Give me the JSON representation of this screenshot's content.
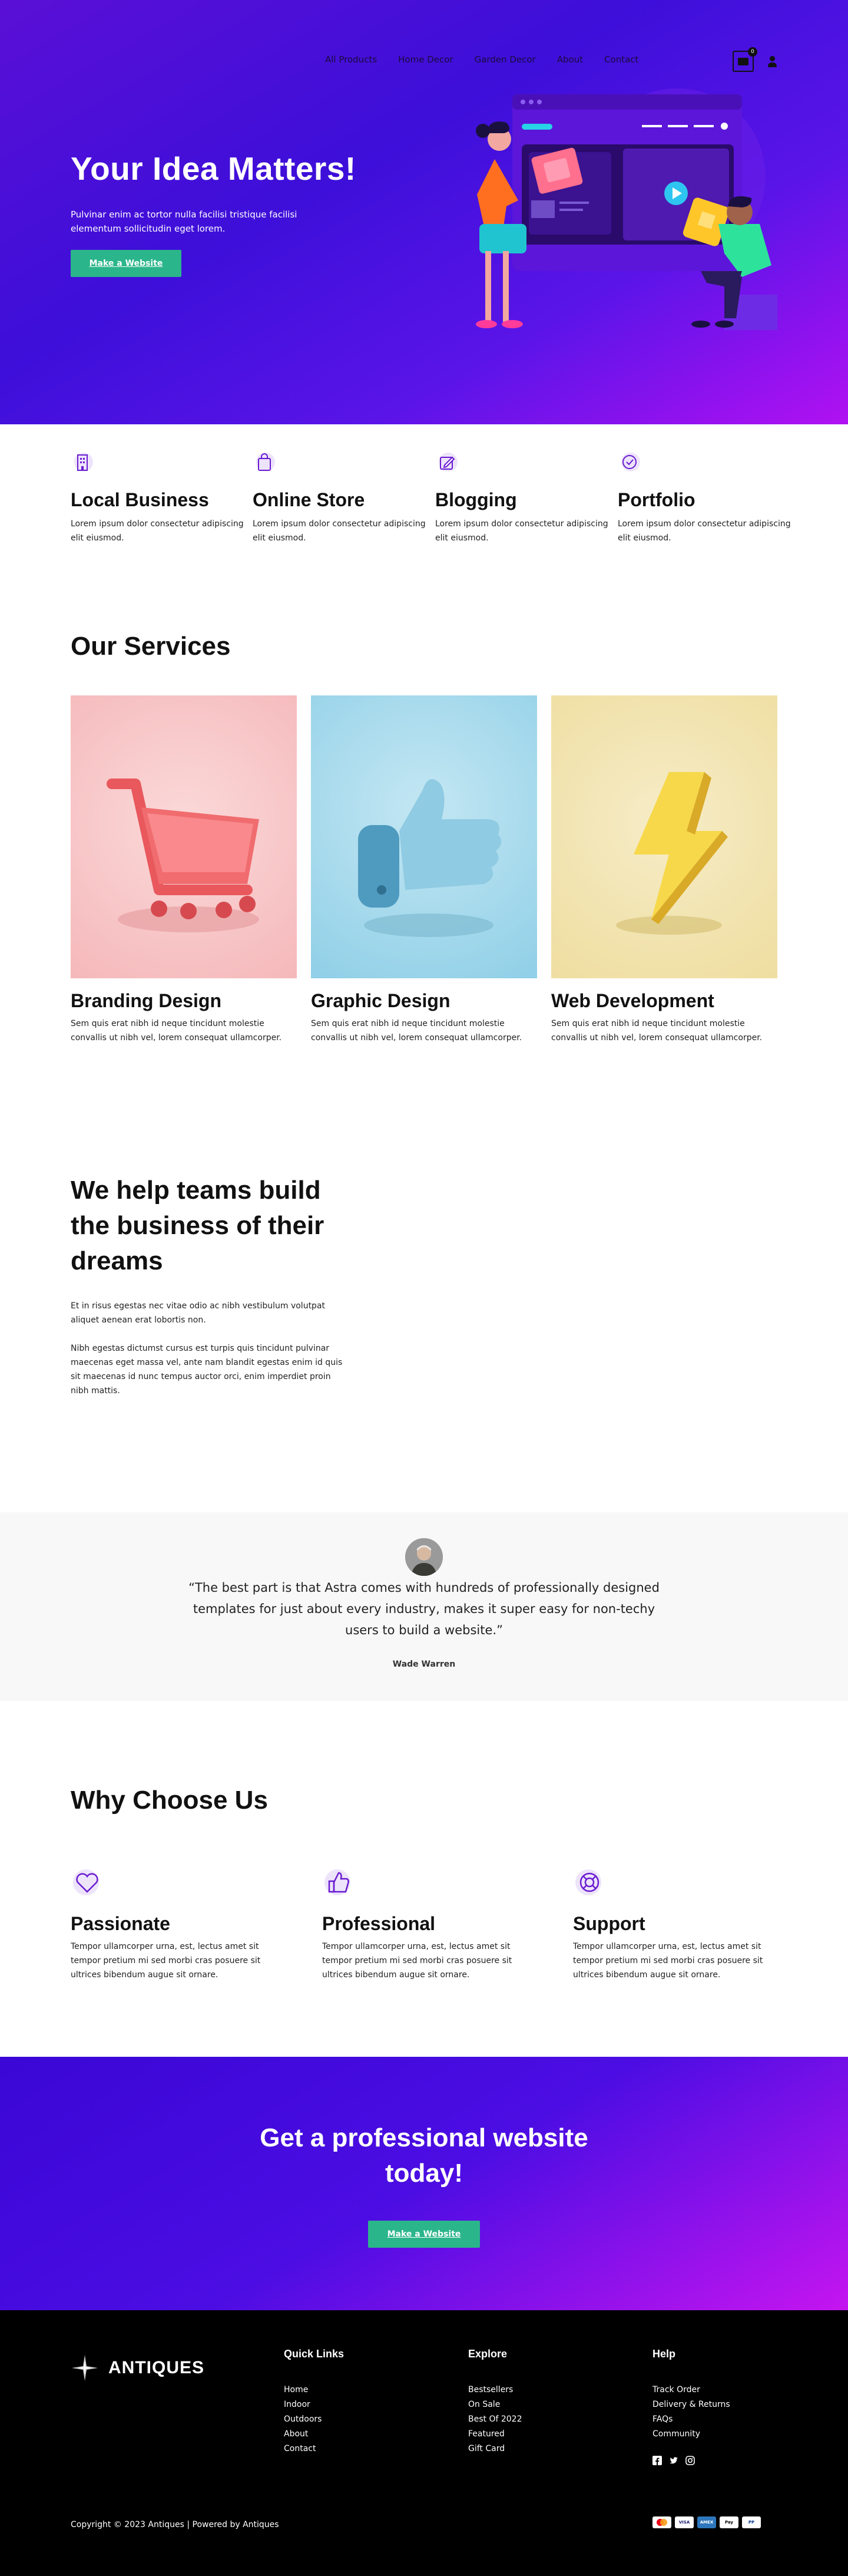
{
  "nav": {
    "links": [
      "All Products",
      "Home Decor",
      "Garden Decor",
      "About",
      "Contact"
    ],
    "cart_count": "0"
  },
  "hero": {
    "title": "Your Idea Matters!",
    "text": "Pulvinar enim ac tortor nulla facilisi tristique facilisi elementum sollicitudin eget lorem.",
    "button": "Make a Website"
  },
  "features": [
    {
      "icon": "building-icon",
      "title": "Local Business",
      "text": "Lorem ipsum dolor consectetur adipiscing elit eiusmod."
    },
    {
      "icon": "shopping-bag-icon",
      "title": "Online Store",
      "text": "Lorem ipsum dolor consectetur adipiscing elit eiusmod."
    },
    {
      "icon": "edit-icon",
      "title": "Blogging",
      "text": "Lorem ipsum dolor consectetur adipiscing elit eiusmod."
    },
    {
      "icon": "badge-check-icon",
      "title": "Portfolio",
      "text": "Lorem ipsum dolor consectetur adipiscing elit eiusmod."
    }
  ],
  "services": {
    "title": "Our Services",
    "items": [
      {
        "image": "shopping-cart-3d",
        "bg": "#f7c3c4",
        "title": "Branding Design",
        "text": "Sem quis erat nibh id neque tincidunt molestie convallis ut nibh vel, lorem consequat ullamcorper."
      },
      {
        "image": "thumbs-up-3d",
        "bg": "#a9d8ea",
        "title": "Graphic Design",
        "text": "Sem quis erat nibh id neque tincidunt molestie convallis ut nibh vel, lorem consequat ullamcorper."
      },
      {
        "image": "lightning-bolt-3d",
        "bg": "#f1e3a9",
        "title": "Web Development",
        "text": "Sem quis erat nibh id neque tincidunt molestie convallis ut nibh vel, lorem consequat ullamcorper."
      }
    ]
  },
  "teams": {
    "title": "We help teams build the business of their dreams",
    "p1": "Et in risus egestas nec vitae odio ac nibh vestibulum volutpat aliquet aenean erat lobortis non.",
    "p2": "Nibh egestas dictumst cursus est turpis quis tincidunt pulvinar maecenas eget massa vel, ante nam blandit egestas enim id quis sit maecenas id nunc tempus auctor orci, enim imperdiet proin nibh mattis."
  },
  "testimonial": {
    "quote": "“The best part is that Astra comes with hundreds of professionally designed templates for just about every industry, makes it super easy for non-techy users to build a website.”",
    "name": "Wade Warren"
  },
  "why": {
    "title": "Why Choose Us",
    "items": [
      {
        "icon": "heart-icon",
        "title": "Passionate",
        "text": "Tempor ullamcorper urna, est, lectus amet sit tempor pretium mi sed morbi cras posuere sit ultrices bibendum augue sit ornare."
      },
      {
        "icon": "thumbs-up-icon",
        "title": "Professional",
        "text": "Tempor ullamcorper urna, est, lectus amet sit tempor pretium mi sed morbi cras posuere sit ultrices bibendum augue sit ornare."
      },
      {
        "icon": "lifebuoy-icon",
        "title": "Support",
        "text": "Tempor ullamcorper urna, est, lectus amet sit tempor pretium mi sed morbi cras posuere sit ultrices bibendum augue sit ornare."
      }
    ]
  },
  "cta": {
    "title": "Get a professional website today!",
    "button": "Make a Website"
  },
  "footer": {
    "logo_text": "ANTIQUES",
    "columns": [
      {
        "title": "Quick Links",
        "links": [
          "Home",
          "Indoor",
          "Outdoors",
          "About",
          "Contact"
        ]
      },
      {
        "title": "Explore",
        "links": [
          "Bestsellers",
          "On Sale",
          "Best Of 2022",
          "Featured",
          "Gift Card"
        ]
      },
      {
        "title": "Help",
        "links": [
          "Track Order",
          "Delivery & Returns",
          "FAQs",
          "Community"
        ]
      }
    ],
    "social_icons": [
      "facebook-icon",
      "twitter-icon",
      "instagram-icon"
    ],
    "copyright": "Copyright © 2023 Antiques | Powered by Antiques",
    "payment_icons": [
      "mastercard-icon",
      "visa-icon",
      "amex-icon",
      "apple-pay-icon",
      "paypal-icon"
    ]
  },
  "colors": {
    "accent_green": "#2bb58a",
    "hero_purple": "#4010d8",
    "hero_magenta": "#b111f2",
    "icon_purple": "#6a1bd1"
  }
}
